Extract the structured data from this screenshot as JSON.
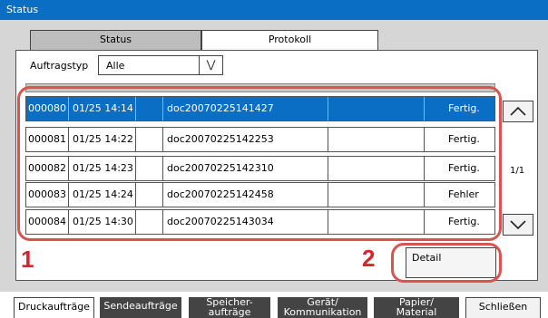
{
  "window": {
    "title": "Status"
  },
  "tabs": [
    {
      "label": "Status",
      "active": false
    },
    {
      "label": "Protokoll",
      "active": true
    }
  ],
  "filter": {
    "label": "Auftragstyp",
    "value": "Alle",
    "icon": "double-chevron-down-icon"
  },
  "list": {
    "rows": [
      {
        "id": "000080",
        "datetime": "01/25 14:14",
        "doc": "doc20070225141427",
        "result": "Fertig.",
        "selected": true
      },
      {
        "id": "000081",
        "datetime": "01/25 14:22",
        "doc": "doc20070225142253",
        "result": "Fertig.",
        "selected": false
      },
      {
        "id": "000082",
        "datetime": "01/25 14:23",
        "doc": "doc20070225142310",
        "result": "Fertig.",
        "selected": false
      },
      {
        "id": "000083",
        "datetime": "01/25 14:24",
        "doc": "doc20070225142458",
        "result": "Fehler",
        "selected": false
      },
      {
        "id": "000084",
        "datetime": "01/25 14:30",
        "doc": "doc20070225143034",
        "result": "Fertig.",
        "selected": false
      }
    ],
    "page_indicator": "1/1",
    "scroll_up_icon": "chevron-up-icon",
    "scroll_down_icon": "chevron-down-icon"
  },
  "actions": {
    "detail_label": "Detail"
  },
  "callouts": {
    "one": "1",
    "two": "2"
  },
  "bottom_tabs": [
    {
      "line1": "Druckaufträge",
      "line2": "",
      "active": true
    },
    {
      "line1": "Sendeaufträge",
      "line2": "",
      "active": false
    },
    {
      "line1": "Speicher-",
      "line2": "aufträge",
      "active": false
    },
    {
      "line1": "Gerät/",
      "line2": "Kommunikation",
      "active": false
    },
    {
      "line1": "Papier/",
      "line2": "Material",
      "active": false
    }
  ],
  "close_button": {
    "label": "Schließen"
  },
  "colors": {
    "title_bar": "#0a6fc4",
    "selection": "#0a6fc4",
    "highlight": "#d9534f",
    "callout": "#d9242c",
    "tab_dark": "#444444"
  }
}
